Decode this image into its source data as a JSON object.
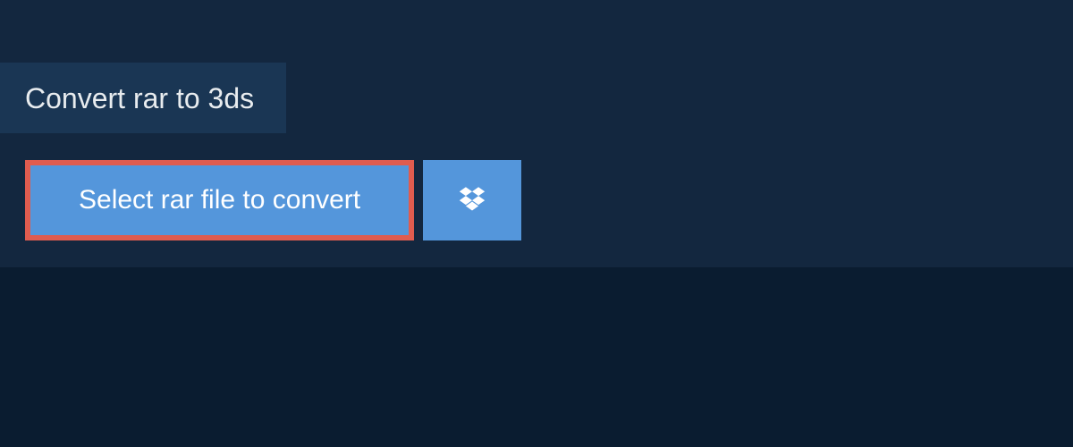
{
  "tab": {
    "title": "Convert rar to 3ds"
  },
  "upload": {
    "select_label": "Select rar file to convert"
  },
  "colors": {
    "page_bg": "#0a1c30",
    "panel_bg": "#13273f",
    "tab_bg": "#1a3654",
    "button_bg": "#5496db",
    "highlight_border": "#e05c4f",
    "text": "#e8ecef"
  }
}
